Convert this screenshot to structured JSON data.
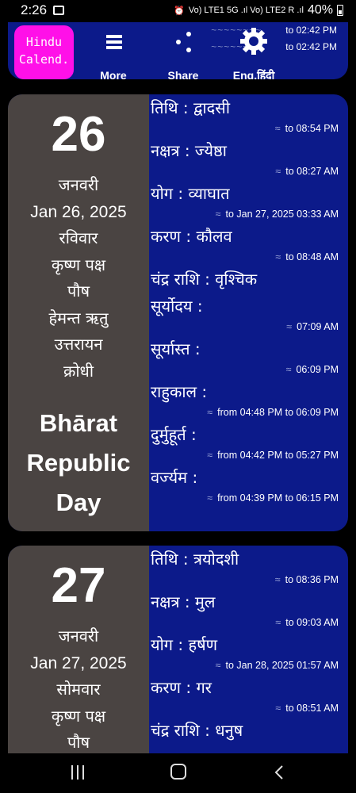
{
  "status_bar": {
    "time": "2:26",
    "network": "Vo) LTE1 5G .ıl Vo) LTE2 R .ıl",
    "battery": "40%"
  },
  "toolbar": {
    "logo_line1": "Hindu",
    "logo_line2": "Calend.",
    "more_label": "More",
    "share_label": "Share",
    "lang_label": "Eng.हिंदी",
    "prev_time1": "to 02:42 PM",
    "prev_time2": "to 02:42 PM",
    "prev_text1": "~~~~~~~~",
    "prev_text2": "~~~~~~~~"
  },
  "days": [
    {
      "day_number": "26",
      "month_hi": "जनवरी",
      "date_en": "Jan 26, 2025",
      "weekday": "रविवार",
      "paksha": "कृष्ण पक्ष",
      "masa": "पौष",
      "ritu": "हेमन्त ऋतु",
      "ayana": "उत्तरायन",
      "samvatsara": "क्रोधी",
      "festival": [
        "Bhārat",
        "Republic",
        "Day"
      ],
      "panchang": [
        {
          "name": "तिथि : द्वादसी",
          "approx": "≈",
          "end": "to 08:54 PM"
        },
        {
          "name": "नक्षत्र : ज्येष्ठा",
          "approx": "≈",
          "end": "to 08:27 AM"
        },
        {
          "name": "योग : व्याघात",
          "approx": "≈",
          "end": "to Jan 27, 2025 03:33 AM"
        },
        {
          "name": "करण : कौलव",
          "approx": "≈",
          "end": "to 08:48 AM"
        },
        {
          "name": "चंद्र राशि : वृश्चिक",
          "approx": "",
          "end": ""
        },
        {
          "name": "सूर्योदय :",
          "approx": "≈",
          "end": "07:09 AM"
        },
        {
          "name": "सूर्यास्त :",
          "approx": "≈",
          "end": "06:09 PM"
        },
        {
          "name": "राहुकाल :",
          "approx": "≈",
          "end": "from 04:48 PM to 06:09 PM"
        },
        {
          "name": "दुर्मुहूर्त :",
          "approx": "≈",
          "end": "from 04:42 PM to 05:27 PM"
        },
        {
          "name": "वर्ज्यम :",
          "approx": "≈",
          "end": "from 04:39 PM to 06:15 PM"
        }
      ]
    },
    {
      "day_number": "27",
      "month_hi": "जनवरी",
      "date_en": "Jan 27, 2025",
      "weekday": "सोमवार",
      "paksha": "कृष्ण पक्ष",
      "masa": "पौष",
      "panchang": [
        {
          "name": "तिथि : त्रयोदशी",
          "approx": "≈",
          "end": "to 08:36 PM"
        },
        {
          "name": "नक्षत्र : मुल",
          "approx": "≈",
          "end": "to 09:03 AM"
        },
        {
          "name": "योग : हर्षण",
          "approx": "≈",
          "end": "to Jan 28, 2025 01:57 AM"
        },
        {
          "name": "करण : गर",
          "approx": "≈",
          "end": "to 08:51 AM"
        },
        {
          "name": "चंद्र राशि : धनुष",
          "approx": "",
          "end": ""
        }
      ]
    }
  ]
}
